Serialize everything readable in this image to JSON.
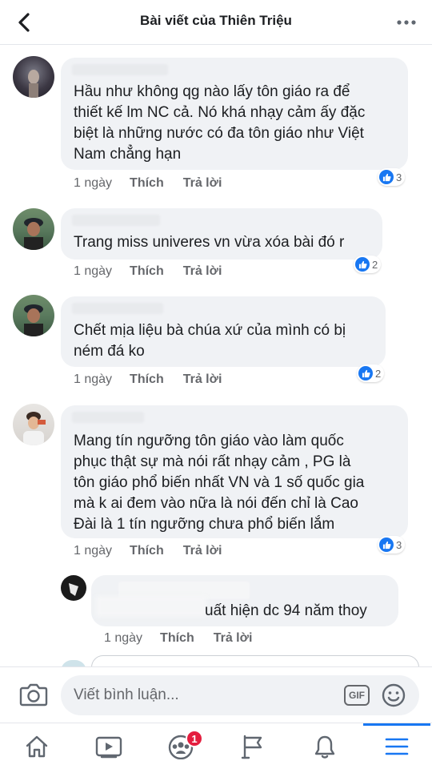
{
  "header": {
    "title": "Bài viết của Thiên Triệu"
  },
  "comments": [
    {
      "text": "Hầu như không qg nào lấy tôn giáo ra để\nthiết kế lm NC cả. Nó khá nhạy cảm ấy đặc\nbiệt là những nước có đa tôn giáo như Việt\nNam chẳng hạn",
      "time": "1 ngày",
      "like_label": "Thích",
      "reply_label": "Trả lời",
      "reactions": "3"
    },
    {
      "text": "Trang miss univeres vn vừa xóa bài đó r",
      "time": "1 ngày",
      "like_label": "Thích",
      "reply_label": "Trả lời",
      "reactions": "2"
    },
    {
      "text": "Chết mịa liệu bà chúa xứ của mình có bị\nném đá ko",
      "time": "1 ngày",
      "like_label": "Thích",
      "reply_label": "Trả lời",
      "reactions": "2"
    },
    {
      "text": "Mang tín ngưỡng tôn giáo vào làm quốc\nphục thật sự mà nói rất nhạy cảm , PG là\ntôn giáo phổ biến nhất VN và 1 số quốc gia\nmà k ai đem vào nữa là nói đến chỉ là Cao\nĐài là 1 tín ngưỡng chưa phổ biến lắm",
      "time": "1 ngày",
      "like_label": "Thích",
      "reply_label": "Trả lời",
      "reactions": "3"
    }
  ],
  "reply": {
    "text": "uất hiện dc 94 năm thoy",
    "time": "1 ngày",
    "like_label": "Thích",
    "reply_label": "Trả lời"
  },
  "composer": {
    "placeholder": "Viết bình luận...",
    "gif_label": "GIF"
  },
  "tabbar": {
    "groups_badge": "1"
  },
  "colors": {
    "accent": "#1877f2",
    "bubble": "#f0f2f5",
    "meta_text": "#65676b",
    "badge": "#e41e3f"
  },
  "icons": [
    "back-arrow-icon",
    "more-dots-icon",
    "like-icon",
    "camera-icon",
    "gif-icon",
    "emoji-icon",
    "home-icon",
    "video-icon",
    "groups-icon",
    "pages-flag-icon",
    "bell-icon",
    "menu-icon"
  ]
}
